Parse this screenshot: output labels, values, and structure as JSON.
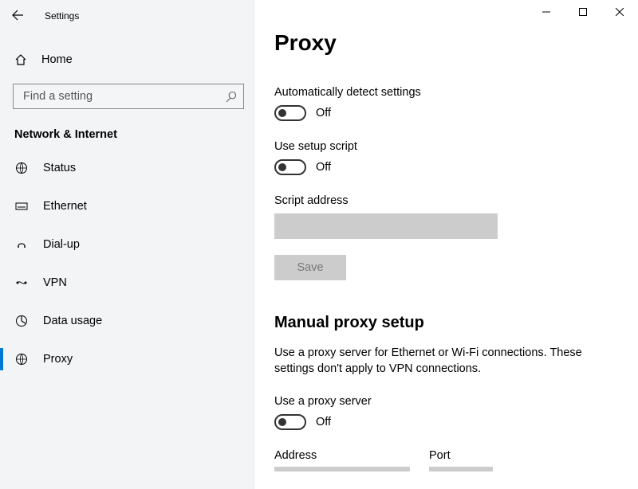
{
  "titlebar": {
    "title": "Settings"
  },
  "sidebar": {
    "home_label": "Home",
    "search_placeholder": "Find a setting",
    "category": "Network & Internet",
    "items": [
      {
        "label": "Status"
      },
      {
        "label": "Ethernet"
      },
      {
        "label": "Dial-up"
      },
      {
        "label": "VPN"
      },
      {
        "label": "Data usage"
      },
      {
        "label": "Proxy"
      }
    ]
  },
  "main": {
    "page_title": "Proxy",
    "auto_detect_label": "Automatically detect settings",
    "auto_detect_state": "Off",
    "setup_script_label": "Use setup script",
    "setup_script_state": "Off",
    "script_address_label": "Script address",
    "save_label": "Save",
    "manual_header": "Manual proxy setup",
    "manual_desc": "Use a proxy server for Ethernet or Wi-Fi connections. These settings don't apply to VPN connections.",
    "use_proxy_label": "Use a proxy server",
    "use_proxy_state": "Off",
    "address_label": "Address",
    "port_label": "Port"
  }
}
